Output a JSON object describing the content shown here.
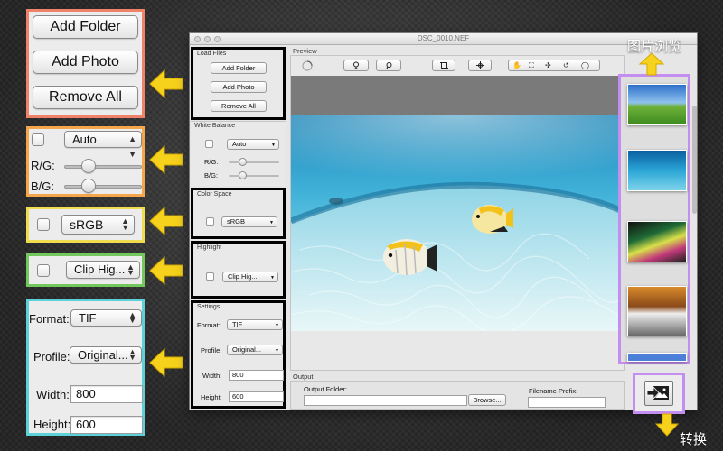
{
  "window": {
    "title": "DSC_0010.NEF"
  },
  "callouts": {
    "load_files": {
      "add_folder": "Add Folder",
      "add_photo": "Add Photo",
      "remove_all": "Remove All"
    },
    "white_balance": {
      "mode": "Auto",
      "rg_label": "R/G:",
      "bg_label": "B/G:",
      "rg_level": 0.48,
      "bg_level": 0.48
    },
    "color_space": {
      "value": "sRGB"
    },
    "highlight": {
      "value": "Clip Hig..."
    },
    "settings": {
      "format_label": "Format:",
      "format_value": "TIF",
      "profile_label": "Profile:",
      "profile_value": "Original...",
      "width_label": "Width:",
      "width_value": "800",
      "height_label": "Height:",
      "height_value": "600"
    }
  },
  "sidebar": {
    "load_files": {
      "title": "Load Files",
      "add_folder": "Add Folder",
      "add_photo": "Add Photo",
      "remove_all": "Remove All"
    },
    "white_balance": {
      "title": "White Balance",
      "mode": "Auto",
      "rg_label": "R/G:",
      "bg_label": "B/G:"
    },
    "color_space": {
      "title": "Color Space",
      "value": "sRGB"
    },
    "highlight": {
      "title": "Highlight",
      "value": "Clip Hig..."
    },
    "settings": {
      "title": "Settings",
      "format_label": "Format:",
      "format_value": "TIF",
      "profile_label": "Profile:",
      "profile_value": "Original...",
      "width_label": "Width:",
      "width_value": "800",
      "height_label": "Height:",
      "height_value": "600"
    }
  },
  "preview": {
    "title": "Preview"
  },
  "output": {
    "title": "Output",
    "folder_label": "Output Folder:",
    "folder_value": "",
    "browse": "Browse...",
    "prefix_label": "Filename Prefix:",
    "prefix_value": ""
  },
  "captions": {
    "browse_images": "图片浏览",
    "convert": "转换"
  },
  "colors": {
    "red": "#f0826a",
    "orange": "#f5a64a",
    "yellow": "#f0dc50",
    "green": "#72c85c",
    "cyan": "#5cd2d8",
    "purple": "#c48ef0",
    "arrow": "#f7d21c"
  }
}
